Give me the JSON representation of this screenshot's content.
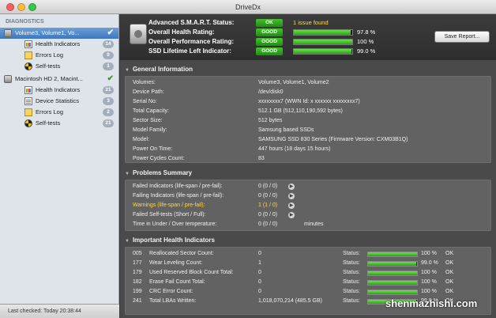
{
  "window": {
    "title": "DriveDx"
  },
  "sidebar": {
    "heading": "DIAGNOSTICS",
    "disk1": {
      "label": "Volume3, Volume1, Vo...",
      "items": [
        {
          "label": "Health Indicators",
          "badge": "14",
          "icon": "health-icon"
        },
        {
          "label": "Errors Log",
          "badge": "0",
          "icon": "log-icon"
        },
        {
          "label": "Self-tests",
          "badge": "1",
          "icon": "selftest-icon"
        }
      ]
    },
    "disk2": {
      "label": "Macintosh HD 2, Macint...",
      "items": [
        {
          "label": "Health Indicators",
          "badge": "21",
          "icon": "health-icon"
        },
        {
          "label": "Device Statistics",
          "badge": "3",
          "icon": "stats-icon"
        },
        {
          "label": "Errors Log",
          "badge": "2",
          "icon": "log-icon"
        },
        {
          "label": "Self-tests",
          "badge": "21",
          "icon": "selftest-icon"
        }
      ]
    },
    "status": "Last checked: Today 20:38:44"
  },
  "header": {
    "smart_label": "Advanced S.M.A.R.T. Status:",
    "smart_pill": "OK",
    "smart_note": "1 issue found",
    "health_label": "Overall Health Rating:",
    "health_pill": "GOOD",
    "health_pct": "97.8 %",
    "health_value": 97.8,
    "perf_label": "Overall Performance Rating:",
    "perf_pill": "GOOD",
    "perf_pct": "100 %",
    "perf_value": 100,
    "ssd_label": "SSD Lifetime Left Indicator:",
    "ssd_pill": "GOOD",
    "ssd_pct": "99.0 %",
    "ssd_value": 99.0,
    "save_button": "Save Report..."
  },
  "general": {
    "title": "General Information",
    "rows": [
      {
        "k": "Volumes:",
        "v": "Volume3, Volume1, Volume2"
      },
      {
        "k": "Device Path:",
        "v": "/dev/disk0"
      },
      {
        "k": "Serial No:",
        "v": "xxxxxxxx7 (WWN Id: x xxxxxx xxxxxxxx7)"
      },
      {
        "k": "Total Capacity:",
        "v": "512.1 GB (512,110,190,592 bytes)"
      },
      {
        "k": "Sector Size:",
        "v": "512 bytes"
      },
      {
        "k": "Model Family:",
        "v": "Samsung based SSDs"
      },
      {
        "k": "Model:",
        "v": "SAMSUNG SSD 830 Series  (Firmware Version: CXM03B1Q)"
      },
      {
        "k": "Power On Time:",
        "v": "447 hours (18 days 15 hours)"
      },
      {
        "k": "Power Cycles Count:",
        "v": "83"
      }
    ]
  },
  "problems": {
    "title": "Problems Summary",
    "rows": [
      {
        "k": "Failed Indicators (life-span / pre-fail):",
        "v": "0 (0 / 0)"
      },
      {
        "k": "Failing Indicators (life-span / pre-fail):",
        "v": "0 (0 / 0)"
      },
      {
        "k": "Warnings (life-span / pre-fail):",
        "v": "1 (1 / 0)"
      },
      {
        "k": "Failed Self-tests (Short / Full):",
        "v": "0 (0 / 0)"
      },
      {
        "k": "Time in Under / Over temperature:",
        "v": "0 (0 / 0)",
        "unit": "minutes"
      }
    ]
  },
  "health": {
    "title": "Important Health Indicators",
    "status_label": "Status:",
    "rows": [
      {
        "code": "005",
        "name": "Reallocated Sector Count:",
        "value": "0",
        "pct": "100 %",
        "level": 100,
        "ok": "OK"
      },
      {
        "code": "177",
        "name": "Wear Leveling Count:",
        "value": "1",
        "pct": "99.0 %",
        "level": 99,
        "ok": "OK"
      },
      {
        "code": "179",
        "name": "Used Reserved Block Count Total:",
        "value": "0",
        "pct": "100 %",
        "level": 100,
        "ok": "OK"
      },
      {
        "code": "182",
        "name": "Erase Fail Count Total:",
        "value": "0",
        "pct": "100 %",
        "level": 100,
        "ok": "OK"
      },
      {
        "code": "199",
        "name": "CRC Error Count:",
        "value": "0",
        "pct": "100 %",
        "level": 100,
        "ok": "OK"
      },
      {
        "code": "241",
        "name": "Total LBAs Written:",
        "value": "1,018,070,214 (485.5 GB)",
        "pct": "99.0 %",
        "level": 99,
        "ok": "OK"
      }
    ]
  },
  "watermark": "shenmazhishi.com",
  "colors": {
    "good": "#2ba31a",
    "warning": "#ffd84a",
    "selection": "#3d76bf"
  }
}
